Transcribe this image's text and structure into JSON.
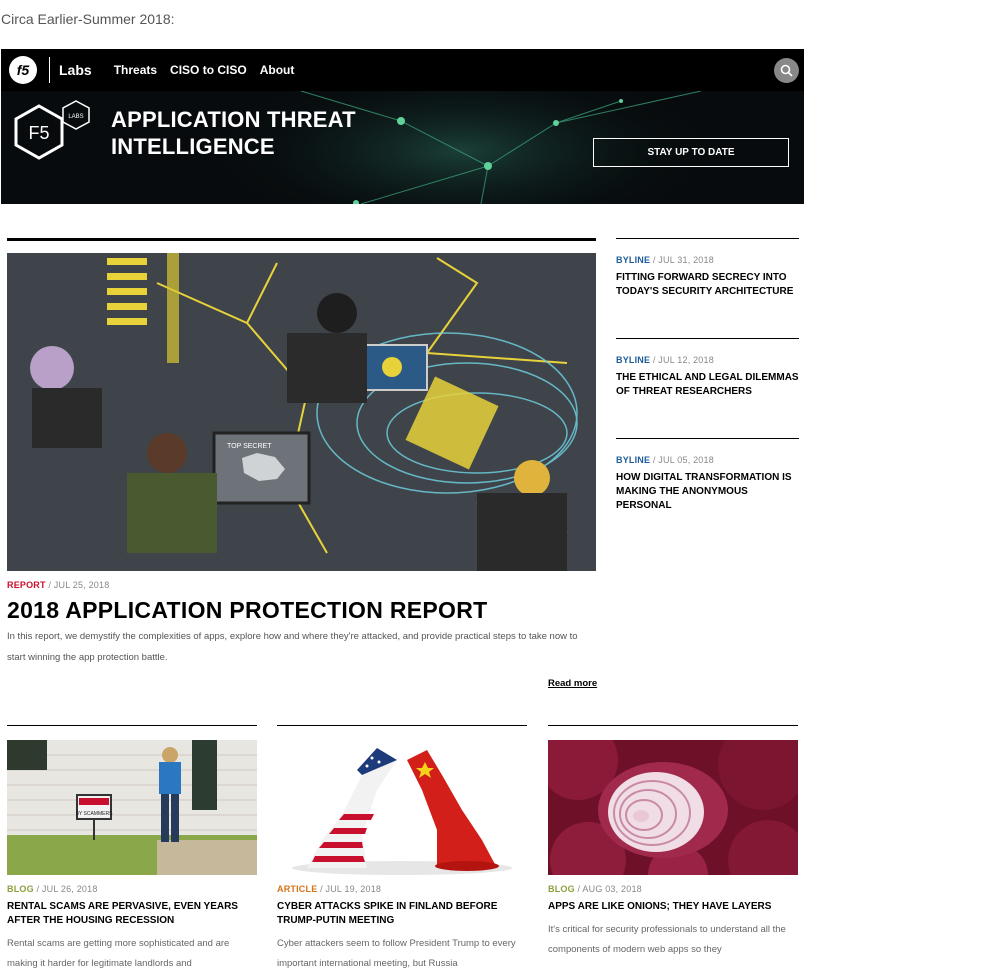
{
  "caption": "Circa Earlier-Summer 2018:",
  "nav": {
    "logo": "f5",
    "labs": "Labs",
    "links": [
      "Threats",
      "CISO to CISO",
      "About"
    ],
    "search_icon": "search-icon"
  },
  "hero": {
    "logo_text": "F5",
    "logo_badge": "LABS",
    "title": "APPLICATION THREAT INTELLIGENCE",
    "cta": "STAY UP TO DATE"
  },
  "feature": {
    "tag": "REPORT",
    "date": "/ JUL 25, 2018",
    "title": "2018 APPLICATION PROTECTION REPORT",
    "description": "In this report, we demystify the complexities of apps, explore how and where they're attacked, and provide practical steps to take now to start winning the app protection battle.",
    "read_more": "Read more",
    "image_label": "TOP SECRET"
  },
  "side": [
    {
      "tag": "BYLINE",
      "date": "/ JUL 31, 2018",
      "title": "FITTING FORWARD SECRECY INTO TODAY'S SECURITY ARCHITECTURE"
    },
    {
      "tag": "BYLINE",
      "date": "/ JUL 12, 2018",
      "title": "THE ETHICAL AND LEGAL DILEMMAS OF THREAT RESEARCHERS"
    },
    {
      "tag": "BYLINE",
      "date": "/ JUL 05, 2018",
      "title": "HOW DIGITAL TRANSFORMATION IS MAKING THE ANONYMOUS PERSONAL"
    }
  ],
  "cards": [
    {
      "tag": "BLOG",
      "date": "/ JUL 26, 2018",
      "title": "RENTAL SCAMS ARE PERVASIVE, EVEN YEARS AFTER THE HOUSING RECESSION",
      "desc": "Rental scams are getting more sophisticated and are making it harder for legitimate landlords and",
      "sign_text": "BY SCAMMERS"
    },
    {
      "tag": "ARTICLE",
      "date": "/ JUL 19, 2018",
      "title": "CYBER ATTACKS SPIKE IN FINLAND BEFORE TRUMP-PUTIN MEETING",
      "desc": "Cyber attackers seem to follow President Trump to every important international meeting, but Russia"
    },
    {
      "tag": "BLOG",
      "date": "/ AUG 03, 2018",
      "title": "APPS ARE LIKE ONIONS; THEY HAVE LAYERS",
      "desc": "It's critical for security professionals to understand all the components of modern web apps so they"
    }
  ]
}
